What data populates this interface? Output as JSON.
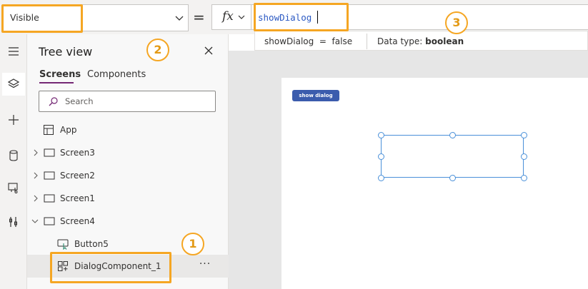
{
  "formula_bar": {
    "property": "Visible",
    "equals": "=",
    "fx_label": "fx",
    "formula": "showDialog"
  },
  "result": {
    "expression": "showDialog  =  false",
    "type_label": "Data type:",
    "type_value": "boolean"
  },
  "tree_view": {
    "title": "Tree view",
    "tabs": [
      "Screens",
      "Components"
    ],
    "search_placeholder": "Search",
    "items": [
      {
        "label": "App"
      },
      {
        "label": "Screen3"
      },
      {
        "label": "Screen2"
      },
      {
        "label": "Screen1"
      },
      {
        "label": "Screen4"
      },
      {
        "label": "Button5"
      },
      {
        "label": "DialogComponent_1"
      }
    ],
    "more": "···"
  },
  "canvas": {
    "button_label": "show dialog"
  },
  "badges": [
    "1",
    "2",
    "3"
  ],
  "colors": {
    "highlight": "#f5a623",
    "accent": "#742774",
    "formula_text": "#2b59c3",
    "button": "#3b5cad",
    "selection": "#4a90d9"
  }
}
